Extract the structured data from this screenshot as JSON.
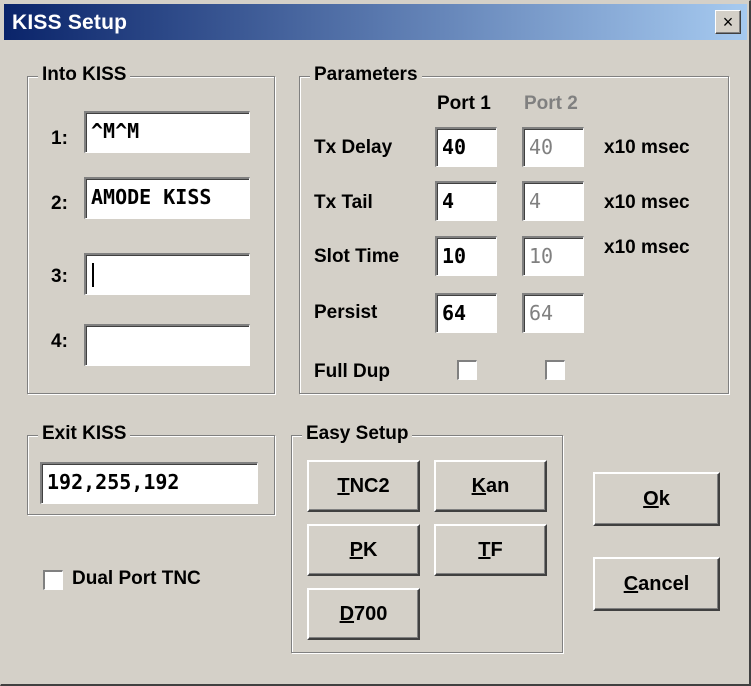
{
  "window": {
    "title": "KISS Setup",
    "close_label": "×"
  },
  "into_kiss": {
    "legend": "Into KISS",
    "rows": [
      {
        "label": "1:",
        "value": "^M^M"
      },
      {
        "label": "2:",
        "value": "AMODE KISS"
      },
      {
        "label": "3:",
        "value": ""
      },
      {
        "label": "4:",
        "value": ""
      }
    ]
  },
  "parameters": {
    "legend": "Parameters",
    "port1_header": "Port 1",
    "port2_header": "Port 2",
    "rows": [
      {
        "label": "Tx Delay",
        "port1": "40",
        "port2": "40",
        "unit": "x10 msec"
      },
      {
        "label": "Tx Tail",
        "port1": "4",
        "port2": "4",
        "unit": "x10 msec"
      },
      {
        "label": "Slot Time",
        "port1": "10",
        "port2": "10",
        "unit": "x10 msec"
      },
      {
        "label": "Persist",
        "port1": "64",
        "port2": "64",
        "unit": ""
      }
    ],
    "full_dup_label": "Full Dup",
    "full_dup_port1": false,
    "full_dup_port2": false
  },
  "exit_kiss": {
    "legend": "Exit KISS",
    "value": "192,255,192"
  },
  "dual_port": {
    "label": "Dual Port TNC",
    "checked": false
  },
  "easy_setup": {
    "legend": "Easy Setup",
    "buttons": [
      {
        "mnemonic": "T",
        "rest": "NC2"
      },
      {
        "mnemonic": "K",
        "rest": "an"
      },
      {
        "mnemonic": "P",
        "rest": "K"
      },
      {
        "mnemonic": "T",
        "rest": "F"
      },
      {
        "mnemonic": "D",
        "rest": "700"
      }
    ]
  },
  "actions": {
    "ok": {
      "mnemonic": "O",
      "rest": "k"
    },
    "cancel": {
      "mnemonic": "C",
      "rest": "ancel"
    }
  }
}
